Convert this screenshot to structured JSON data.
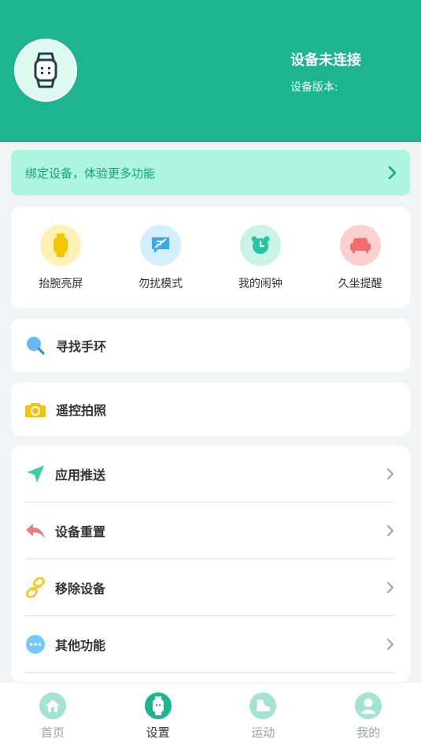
{
  "header": {
    "device_status": "设备未连接",
    "version_label": "设备版本:",
    "version_value": ""
  },
  "bind_banner": {
    "text": "绑定设备，体验更多功能"
  },
  "quick_actions": [
    {
      "label": "抬腕亮屏",
      "icon": "watch-raise-icon",
      "color": "#f7c500",
      "bg": "#fff0b3"
    },
    {
      "label": "勿扰模式",
      "icon": "no-disturb-message-icon",
      "color": "#36a8f0",
      "bg": "#d3eefc"
    },
    {
      "label": "我的闹钟",
      "icon": "alarm-clock-icon",
      "color": "#22c7a1",
      "bg": "#c9f3e7"
    },
    {
      "label": "久坐提醒",
      "icon": "sofa-icon",
      "color": "#f26d6d",
      "bg": "#fdd0d0"
    }
  ],
  "find_band": {
    "label": "寻找手环",
    "icon": "search-icon"
  },
  "remote_photo": {
    "label": "遥控拍照",
    "icon": "camera-icon"
  },
  "settings_list": [
    {
      "label": "应用推送",
      "icon": "send-icon"
    },
    {
      "label": "设备重置",
      "icon": "reset-arrow-icon"
    },
    {
      "label": "移除设备",
      "icon": "unlink-icon"
    },
    {
      "label": "其他功能",
      "icon": "more-dots-icon"
    }
  ],
  "tabbar": [
    {
      "label": "首页",
      "icon": "home-icon",
      "active": false
    },
    {
      "label": "设置",
      "icon": "watch-icon",
      "active": true
    },
    {
      "label": "运动",
      "icon": "shoe-icon",
      "active": false
    },
    {
      "label": "我的",
      "icon": "user-icon",
      "active": false
    }
  ],
  "colors": {
    "brand": "#1db58f",
    "banner_bg": "#adf5de",
    "tab_active": "#1db58f",
    "tab_inactive": "#a3e3d1"
  }
}
